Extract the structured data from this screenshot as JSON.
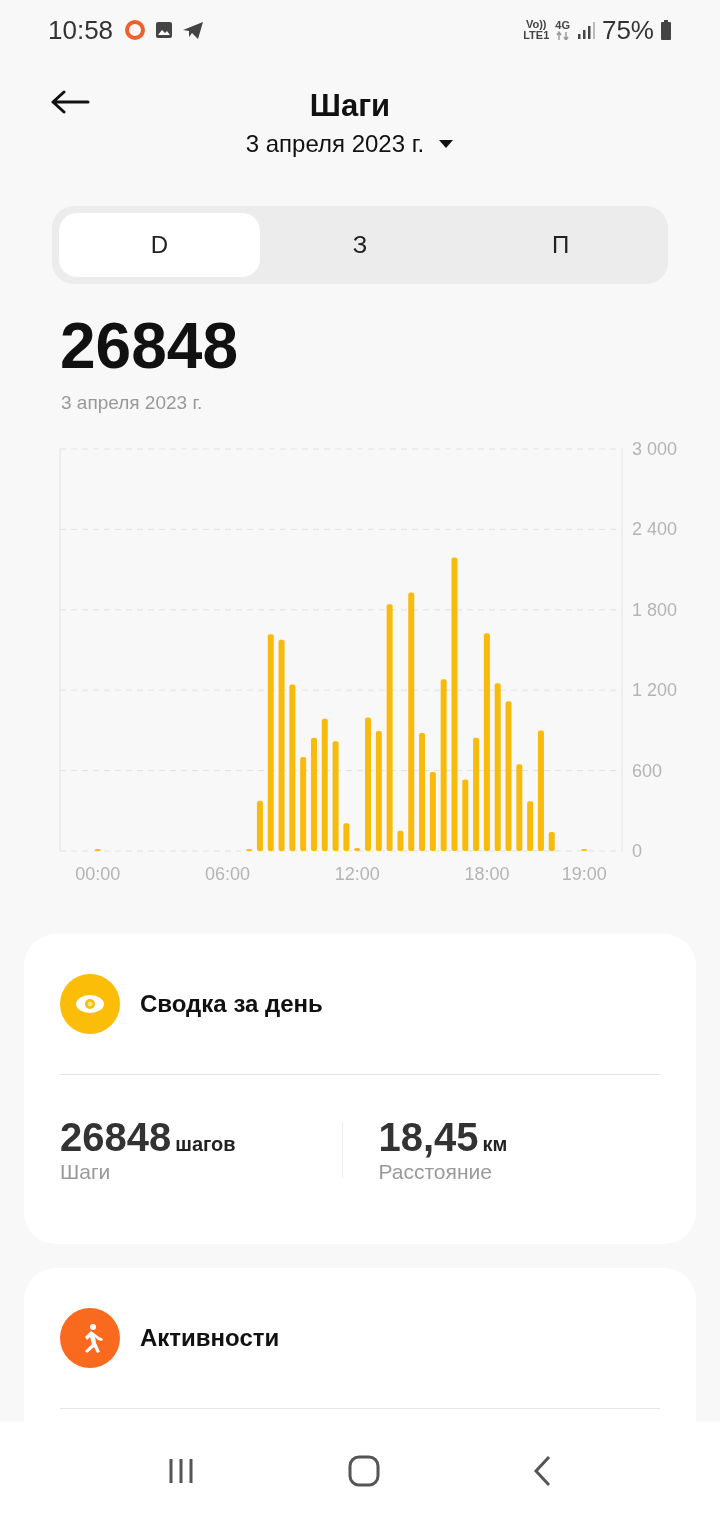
{
  "status_bar": {
    "time": "10:58",
    "network_top": "Vo))",
    "network_bottom": "LTE1",
    "data_type": "4G",
    "battery": "75%"
  },
  "header": {
    "title": "Шаги",
    "date": "3 апреля 2023 г."
  },
  "tabs": [
    {
      "label": "D",
      "selected": true
    },
    {
      "label": "З",
      "selected": false
    },
    {
      "label": "П",
      "selected": false
    }
  ],
  "summary": {
    "total": "26848",
    "date": "3 апреля 2023 г."
  },
  "chart": {
    "chart_data": {
      "type": "bar",
      "categories": [
        "00:00",
        null,
        null,
        null,
        null,
        null,
        null,
        null,
        null,
        null,
        null,
        null,
        "06:00",
        null,
        null,
        null,
        null,
        null,
        null,
        null,
        null,
        null,
        null,
        null,
        "12:00",
        null,
        null,
        null,
        null,
        null,
        null,
        null,
        null,
        null,
        null,
        null,
        "18:00",
        null,
        null,
        null,
        null,
        null,
        null,
        null,
        null,
        "19:00"
      ],
      "series": [
        {
          "color": "#f8bb0c",
          "values": [
            10,
            0,
            0,
            0,
            0,
            0,
            0,
            0,
            0,
            0,
            0,
            0,
            0,
            0,
            10,
            375,
            1618,
            1576,
            1243,
            702,
            845,
            987,
            819,
            207,
            23,
            997,
            896,
            1841,
            152,
            1929,
            880,
            589,
            1282,
            2191,
            534,
            845,
            1625,
            1252,
            1117,
            647,
            372,
            900,
            142,
            0,
            0,
            10
          ]
        }
      ],
      "ylim": [
        0,
        3000
      ],
      "grid": true,
      "yticks": [
        {
          "value": 0,
          "label": "0"
        },
        {
          "value": 600,
          "label": "600"
        },
        {
          "value": 1200,
          "label": "1 200"
        },
        {
          "value": 1800,
          "label": "1 800"
        },
        {
          "value": 2400,
          "label": "2 400"
        },
        {
          "value": 3000,
          "label": "3 000"
        }
      ]
    }
  },
  "cards": [
    {
      "kind": "summary",
      "title": "Сводка за день",
      "color": "#fbbd08",
      "stats": [
        {
          "value": "26848",
          "unit": "шагов",
          "label": "Шаги"
        },
        {
          "value": "18,45",
          "unit": "км",
          "label": "Расстояние"
        }
      ]
    },
    {
      "kind": "activities",
      "title": "Активности",
      "color": "#fa6a1e"
    }
  ]
}
